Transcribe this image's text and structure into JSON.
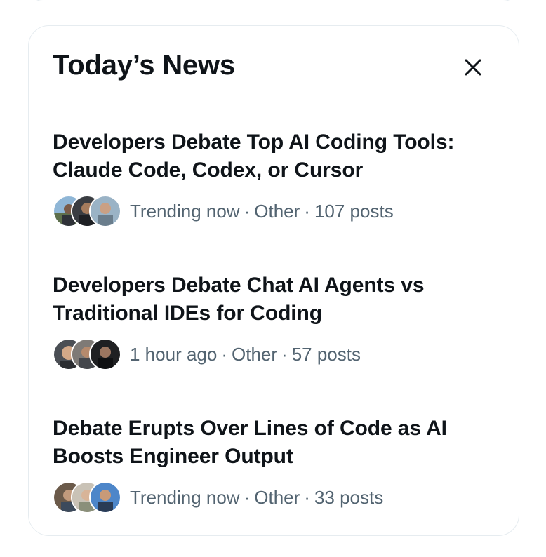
{
  "panel": {
    "title": "Today’s News",
    "close_icon": "close-icon"
  },
  "items": [
    {
      "headline_line1": "Developers Debate Top AI Coding Tools:",
      "headline_line2": "Claude Code, Codex, or Cursor",
      "time": "Trending now",
      "category": "Other",
      "posts": "107 posts"
    },
    {
      "headline_line1": "Developers Debate Chat AI Agents vs",
      "headline_line2": "Traditional IDEs for Coding",
      "time": "1 hour ago",
      "category": "Other",
      "posts": "57 posts"
    },
    {
      "headline_line1": "Debate Erupts Over Lines of Code as AI",
      "headline_line2": "Boosts Engineer Output",
      "time": "Trending now",
      "category": "Other",
      "posts": "33 posts"
    }
  ],
  "colors": {
    "text_primary": "#0f1419",
    "text_secondary": "#536471",
    "border": "#e6ecf0"
  }
}
